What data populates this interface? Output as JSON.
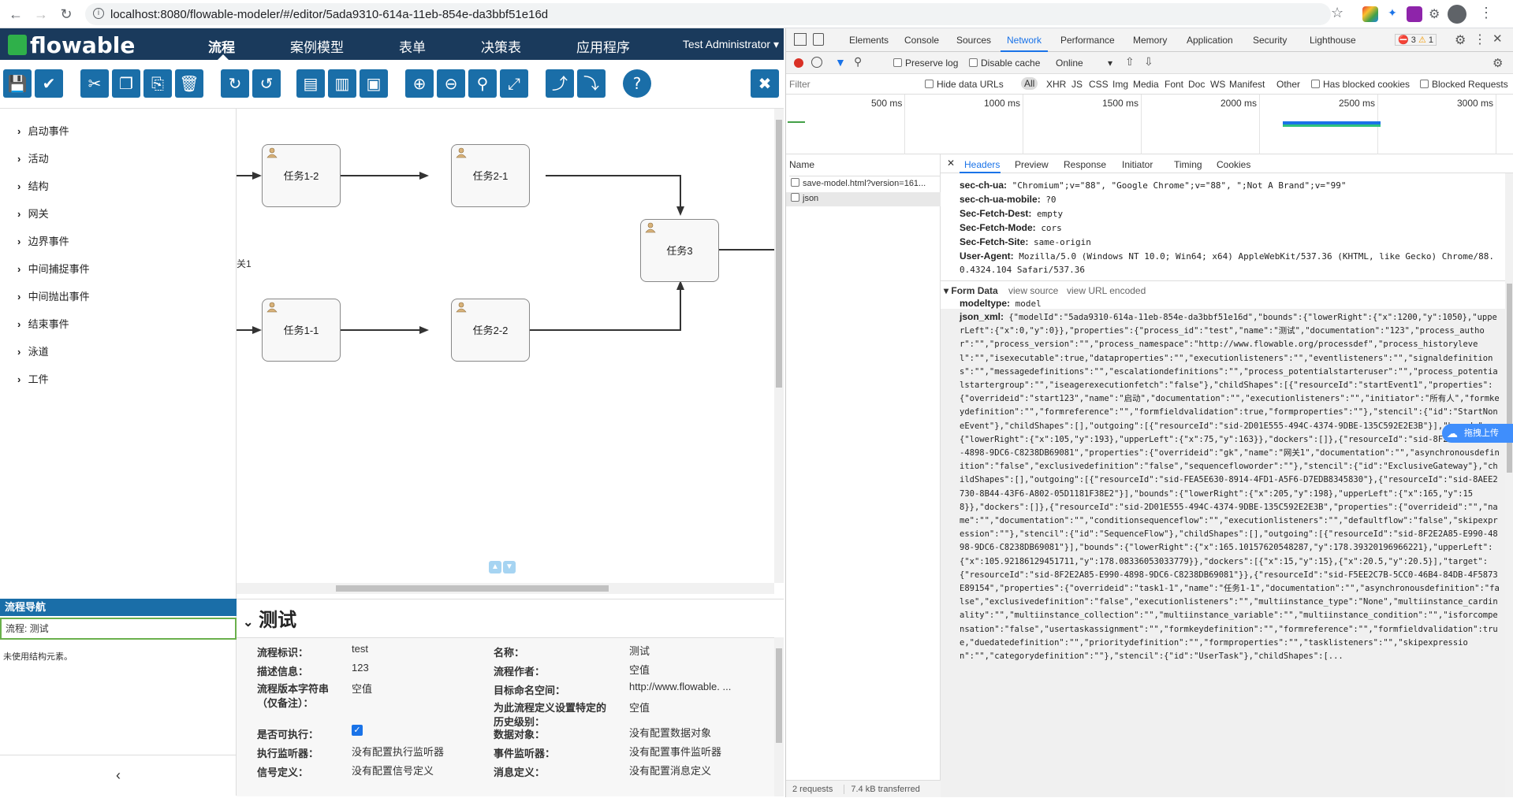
{
  "browser": {
    "url": "localhost:8080/flowable-modeler/#/editor/5ada9310-614a-11eb-854e-da3bbf51e16d"
  },
  "app": {
    "logo": "flowable",
    "nav": [
      "流程",
      "案例模型",
      "表单",
      "决策表",
      "应用程序"
    ],
    "user": "Test Administrator"
  },
  "palette": [
    "启动事件",
    "活动",
    "结构",
    "网关",
    "边界事件",
    "中间捕捉事件",
    "中间抛出事件",
    "结束事件",
    "泳道",
    "工件"
  ],
  "navigation": {
    "title": "流程导航",
    "row": "流程: 测试",
    "empty": "未使用结构元素。"
  },
  "canvas": {
    "tasks": [
      "任务1-2",
      "任务2-1",
      "任务3",
      "任务1-1",
      "任务2-2"
    ],
    "gateway_label": "关1"
  },
  "properties": {
    "title": "测试",
    "fields": [
      {
        "label": "流程标识：",
        "value": "test"
      },
      {
        "label": "名称：",
        "value": "测试"
      },
      {
        "label": "描述信息：",
        "value": "123"
      },
      {
        "label": "流程作者：",
        "value": "空值"
      },
      {
        "label": "流程版本字符串（仅备注）：",
        "value": "空值"
      },
      {
        "label": "目标命名空间：",
        "value": "http://www.flowable. ..."
      },
      {
        "label": "为此流程定义设置特定的历史级别：",
        "value": "空值"
      },
      {
        "label": "是否可执行：",
        "value": ""
      },
      {
        "label": "数据对象：",
        "value": "没有配置数据对象"
      },
      {
        "label": "执行监听器：",
        "value": "没有配置执行监听器"
      },
      {
        "label": "事件监听器：",
        "value": "没有配置事件监听器"
      },
      {
        "label": "信号定义：",
        "value": "没有配置信号定义"
      },
      {
        "label": "消息定义：",
        "value": "没有配置消息定义"
      }
    ]
  },
  "devtools": {
    "tabs": [
      "Elements",
      "Console",
      "Sources",
      "Network",
      "Performance",
      "Memory",
      "Application",
      "Security",
      "Lighthouse"
    ],
    "errors": "3",
    "warnings": "1",
    "preserve_log": "Preserve log",
    "disable_cache": "Disable cache",
    "throttle": "Online",
    "filter_placeholder": "Filter",
    "hide_data_urls": "Hide data URLs",
    "types": [
      "All",
      "XHR",
      "JS",
      "CSS",
      "Img",
      "Media",
      "Font",
      "Doc",
      "WS",
      "Manifest",
      "Other"
    ],
    "has_blocked_cookies": "Has blocked cookies",
    "blocked_requests": "Blocked Requests",
    "timeline": [
      "500 ms",
      "1000 ms",
      "1500 ms",
      "2000 ms",
      "2500 ms",
      "3000 ms"
    ],
    "name_header": "Name",
    "requests": [
      "save-model.html?version=161...",
      "json"
    ],
    "status_requests": "2 requests",
    "status_transferred": "7.4 kB transferred",
    "subtabs": [
      "Headers",
      "Preview",
      "Response",
      "Initiator",
      "Timing",
      "Cookies"
    ],
    "headers": [
      {
        "k": "sec-ch-ua:",
        "v": "\"Chromium\";v=\"88\", \"Google Chrome\";v=\"88\", \";Not A Brand\";v=\"99\""
      },
      {
        "k": "sec-ch-ua-mobile:",
        "v": "?0"
      },
      {
        "k": "Sec-Fetch-Dest:",
        "v": "empty"
      },
      {
        "k": "Sec-Fetch-Mode:",
        "v": "cors"
      },
      {
        "k": "Sec-Fetch-Site:",
        "v": "same-origin"
      },
      {
        "k": "User-Agent:",
        "v": "Mozilla/5.0 (Windows NT 10.0; Win64; x64) AppleWebKit/537.36 (KHTML, like Gecko) Chrome/88."
      },
      {
        "k": "",
        "v": "0.4324.104 Safari/537.36"
      }
    ],
    "form_data": "Form Data",
    "view_source": "view source",
    "view_url_encoded": "view URL encoded",
    "modeltype_key": "modeltype:",
    "modeltype_val": "model",
    "json_xml_key": "json_xml:",
    "json_xml_val": "{\"modelId\":\"5ada9310-614a-11eb-854e-da3bbf51e16d\",\"bounds\":{\"lowerRight\":{\"x\":1200,\"y\":1050},\"upperLeft\":{\"x\":0,\"y\":0}},\"properties\":{\"process_id\":\"test\",\"name\":\"测试\",\"documentation\":\"123\",\"process_author\":\"\",\"process_version\":\"\",\"process_namespace\":\"http://www.flowable.org/processdef\",\"process_historylevel\":\"\",\"isexecutable\":true,\"dataproperties\":\"\",\"executionlisteners\":\"\",\"eventlisteners\":\"\",\"signaldefinitions\":\"\",\"messagedefinitions\":\"\",\"escalationdefinitions\":\"\",\"process_potentialstarteruser\":\"\",\"process_potentialstartergroup\":\"\",\"iseagerexecutionfetch\":\"false\"},\"childShapes\":[{\"resourceId\":\"startEvent1\",\"properties\":{\"overrideid\":\"start123\",\"name\":\"启动\",\"documentation\":\"\",\"executionlisteners\":\"\",\"initiator\":\"所有人\",\"formkeydefinition\":\"\",\"formreference\":\"\",\"formfieldvalidation\":true,\"formproperties\":\"\"},\"stencil\":{\"id\":\"StartNoneEvent\"},\"childShapes\":[],\"outgoing\":[{\"resourceId\":\"sid-2D01E555-494C-4374-9DBE-135C592E2E3B\"}],\"bounds\":{\"lowerRight\":{\"x\":105,\"y\":193},\"upperLeft\":{\"x\":75,\"y\":163}},\"dockers\":[]},{\"resourceId\":\"sid-8F2E2A85-E990-4898-9DC6-C8238DB69081\",\"properties\":{\"overrideid\":\"gk\",\"name\":\"网关1\",\"documentation\":\"\",\"asynchronousdefinition\":\"false\",\"exclusivedefinition\":\"false\",\"sequencefloworder\":\"\"},\"stencil\":{\"id\":\"ExclusiveGateway\"},\"childShapes\":[],\"outgoing\":[{\"resourceId\":\"sid-FEA5E630-8914-4FD1-A5F6-D7EDB8345830\"},{\"resourceId\":\"sid-8AEE2730-8B44-43F6-A802-05D1181F38E2\"}],\"bounds\":{\"lowerRight\":{\"x\":205,\"y\":198},\"upperLeft\":{\"x\":165,\"y\":158}},\"dockers\":[]},{\"resourceId\":\"sid-2D01E555-494C-4374-9DBE-135C592E2E3B\",\"properties\":{\"overrideid\":\"\",\"name\":\"\",\"documentation\":\"\",\"conditionsequenceflow\":\"\",\"executionlisteners\":\"\",\"defaultflow\":\"false\",\"skipexpression\":\"\"},\"stencil\":{\"id\":\"SequenceFlow\"},\"childShapes\":[],\"outgoing\":[{\"resourceId\":\"sid-8F2E2A85-E990-4898-9DC6-C8238DB69081\"}],\"bounds\":{\"lowerRight\":{\"x\":165.10157620548287,\"y\":178.39320196966221},\"upperLeft\":{\"x\":105.92186129451711,\"y\":178.08336053033779}},\"dockers\":[{\"x\":15,\"y\":15},{\"x\":20.5,\"y\":20.5}],\"target\":{\"resourceId\":\"sid-8F2E2A85-E990-4898-9DC6-C8238DB69081\"}},{\"resourceId\":\"sid-F5EE2C7B-5CC0-46B4-84DB-4F5873E89154\",\"properties\":{\"overrideid\":\"task1-1\",\"name\":\"任务1-1\",\"documentation\":\"\",\"asynchronousdefinition\":\"false\",\"exclusivedefinition\":\"false\",\"executionlisteners\":\"\",\"multiinstance_type\":\"None\",\"multiinstance_cardinality\":\"\",\"multiinstance_collection\":\"\",\"multiinstance_variable\":\"\",\"multiinstance_condition\":\"\",\"isforcompensation\":\"false\",\"usertaskassignment\":\"\",\"formkeydefinition\":\"\",\"formreference\":\"\",\"formfieldvalidation\":true,\"duedatedefinition\":\"\",\"prioritydefinition\":\"\",\"formproperties\":\"\",\"tasklisteners\":\"\",\"skipexpression\":\"\",\"categorydefinition\":\"\"},\"stencil\":{\"id\":\"UserTask\"},\"childShapes\":[...",
    "baidu_label": "拖拽上传"
  }
}
